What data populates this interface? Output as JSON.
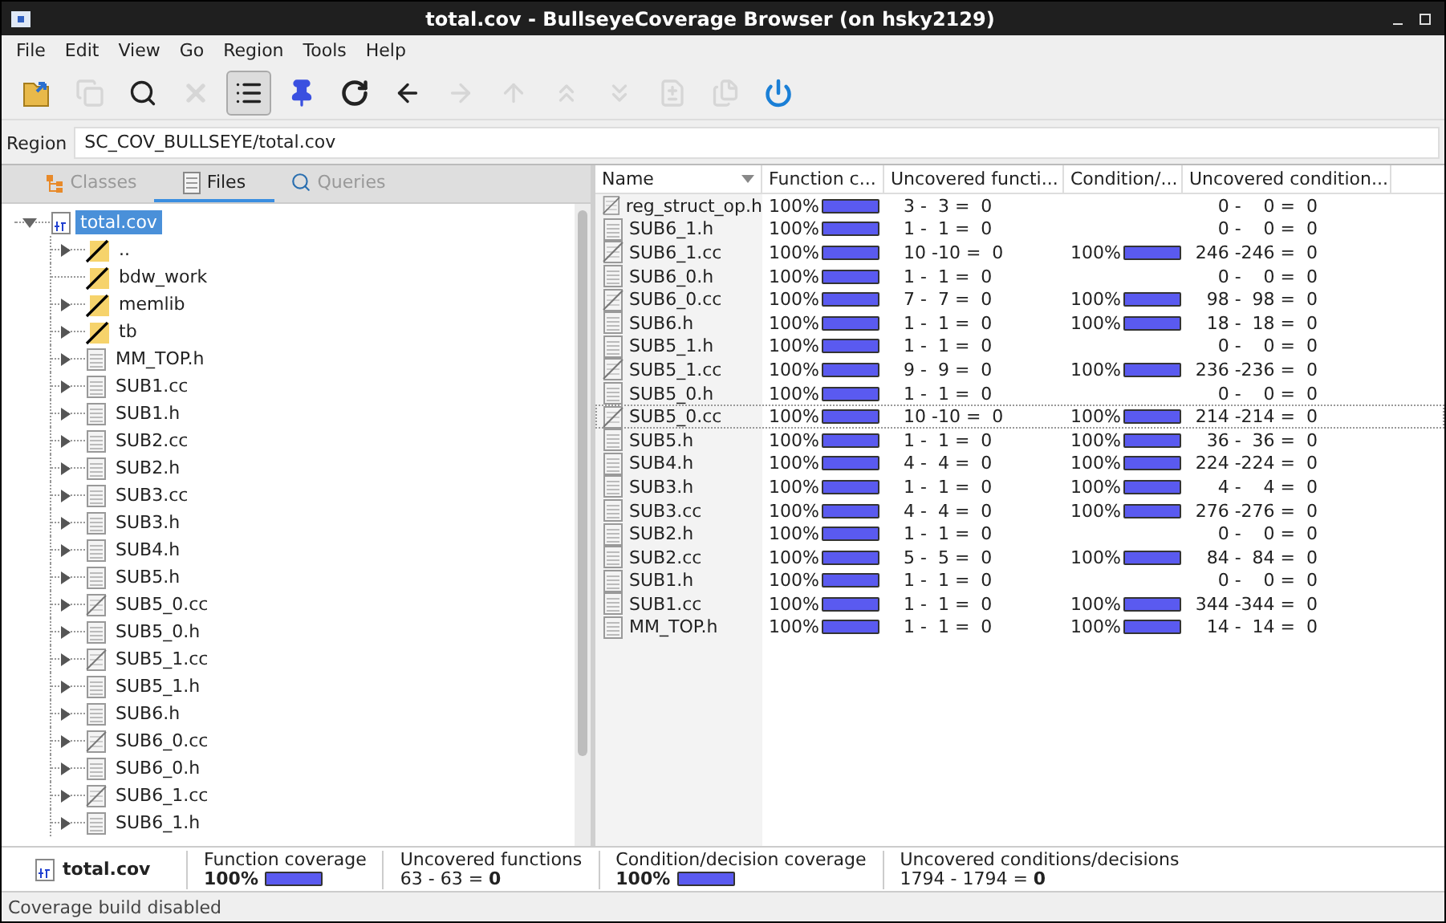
{
  "window": {
    "title": "total.cov - BullseyeCoverage Browser (on hsky2129)"
  },
  "menu": [
    "File",
    "Edit",
    "View",
    "Go",
    "Region",
    "Tools",
    "Help"
  ],
  "toolbar": [
    {
      "kind": "open",
      "disabled": false,
      "pressed": false
    },
    {
      "kind": "copy",
      "disabled": true,
      "pressed": false
    },
    {
      "kind": "find",
      "disabled": false,
      "pressed": false
    },
    {
      "kind": "delete",
      "disabled": true,
      "pressed": false
    },
    {
      "kind": "list",
      "disabled": false,
      "pressed": true
    },
    {
      "kind": "pin",
      "disabled": false,
      "pressed": false
    },
    {
      "kind": "refresh",
      "disabled": false,
      "pressed": false
    },
    {
      "kind": "back",
      "disabled": false,
      "pressed": false
    },
    {
      "kind": "forward",
      "disabled": true,
      "pressed": false
    },
    {
      "kind": "up",
      "disabled": true,
      "pressed": false
    },
    {
      "kind": "first",
      "disabled": true,
      "pressed": false
    },
    {
      "kind": "last",
      "disabled": true,
      "pressed": false
    },
    {
      "kind": "compare-prev",
      "disabled": true,
      "pressed": false
    },
    {
      "kind": "compare-next",
      "disabled": true,
      "pressed": false
    },
    {
      "kind": "power",
      "disabled": false,
      "pressed": false
    }
  ],
  "region": {
    "label": "Region",
    "value": "SC_COV_BULLSEYE/total.cov"
  },
  "tabs": [
    {
      "label": "Classes",
      "kind": "classes",
      "selected": false,
      "disabled": true
    },
    {
      "label": "Files",
      "kind": "files",
      "selected": true,
      "disabled": false
    },
    {
      "label": "Queries",
      "kind": "queries",
      "selected": false,
      "disabled": true
    }
  ],
  "tree": [
    {
      "label": "total.cov",
      "kind": "cov",
      "selected": true,
      "expanded": true,
      "children": [
        {
          "label": "..",
          "kind": "folder",
          "expandable": true
        },
        {
          "label": "bdw_work",
          "kind": "folder",
          "expandable": false
        },
        {
          "label": "memlib",
          "kind": "folder",
          "expandable": true
        },
        {
          "label": "tb",
          "kind": "folder",
          "expandable": true
        },
        {
          "label": "MM_TOP.h",
          "kind": "file",
          "expandable": true
        },
        {
          "label": "SUB1.cc",
          "kind": "file",
          "expandable": true
        },
        {
          "label": "SUB1.h",
          "kind": "file",
          "expandable": true
        },
        {
          "label": "SUB2.cc",
          "kind": "file",
          "expandable": true
        },
        {
          "label": "SUB2.h",
          "kind": "file",
          "expandable": true
        },
        {
          "label": "SUB3.cc",
          "kind": "file",
          "expandable": true
        },
        {
          "label": "SUB3.h",
          "kind": "file",
          "expandable": true
        },
        {
          "label": "SUB4.h",
          "kind": "file",
          "expandable": true
        },
        {
          "label": "SUB5.h",
          "kind": "file",
          "expandable": true
        },
        {
          "label": "SUB5_0.cc",
          "kind": "file-partial",
          "expandable": true
        },
        {
          "label": "SUB5_0.h",
          "kind": "file",
          "expandable": true
        },
        {
          "label": "SUB5_1.cc",
          "kind": "file-partial",
          "expandable": true
        },
        {
          "label": "SUB5_1.h",
          "kind": "file",
          "expandable": true
        },
        {
          "label": "SUB6.h",
          "kind": "file",
          "expandable": true
        },
        {
          "label": "SUB6_0.cc",
          "kind": "file-partial",
          "expandable": true
        },
        {
          "label": "SUB6_0.h",
          "kind": "file",
          "expandable": true
        },
        {
          "label": "SUB6_1.cc",
          "kind": "file-partial",
          "expandable": true
        },
        {
          "label": "SUB6_1.h",
          "kind": "file",
          "expandable": true
        }
      ]
    }
  ],
  "table": {
    "columns": [
      "Name",
      "Function c...",
      "Uncovered functi...",
      "Condition/...",
      "Uncovered condition..."
    ],
    "rows": [
      {
        "name": "reg_struct_op.h",
        "kind": "file-partial",
        "selected": false,
        "function_coverage": {
          "value": "100%",
          "level": 1
        },
        "uncovered_functions": "3 -  3 =  0",
        "uncovered_conditions": "0 -    0 =  0"
      },
      {
        "name": "SUB6_1.h",
        "kind": "file",
        "selected": false,
        "function_coverage": {
          "value": "100%",
          "level": 1
        },
        "uncovered_functions": "1 -  1 =  0",
        "uncovered_conditions": "0 -    0 =  0"
      },
      {
        "name": "SUB6_1.cc",
        "kind": "file-partial",
        "selected": false,
        "function_coverage": {
          "value": "100%",
          "level": 1
        },
        "uncovered_functions": "10 -10 =  0",
        "condition_coverage": {
          "value": "100%",
          "level": 1
        },
        "uncovered_conditions": "246 -246 =  0"
      },
      {
        "name": "SUB6_0.h",
        "kind": "file",
        "selected": false,
        "function_coverage": {
          "value": "100%",
          "level": 1
        },
        "uncovered_functions": "1 -  1 =  0",
        "uncovered_conditions": "0 -    0 =  0"
      },
      {
        "name": "SUB6_0.cc",
        "kind": "file-partial",
        "selected": false,
        "function_coverage": {
          "value": "100%",
          "level": 1
        },
        "uncovered_functions": "7 -  7 =  0",
        "condition_coverage": {
          "value": "100%",
          "level": 1
        },
        "uncovered_conditions": "98 -  98 =  0"
      },
      {
        "name": "SUB6.h",
        "kind": "file",
        "selected": false,
        "function_coverage": {
          "value": "100%",
          "level": 1
        },
        "uncovered_functions": "1 -  1 =  0",
        "condition_coverage": {
          "value": "100%",
          "level": 1
        },
        "uncovered_conditions": "18 -  18 =  0"
      },
      {
        "name": "SUB5_1.h",
        "kind": "file",
        "selected": false,
        "function_coverage": {
          "value": "100%",
          "level": 1
        },
        "uncovered_functions": "1 -  1 =  0",
        "uncovered_conditions": "0 -    0 =  0"
      },
      {
        "name": "SUB5_1.cc",
        "kind": "file-partial",
        "selected": false,
        "function_coverage": {
          "value": "100%",
          "level": 1
        },
        "uncovered_functions": "9 -  9 =  0",
        "condition_coverage": {
          "value": "100%",
          "level": 1
        },
        "uncovered_conditions": "236 -236 =  0"
      },
      {
        "name": "SUB5_0.h",
        "kind": "file",
        "selected": false,
        "function_coverage": {
          "value": "100%",
          "level": 1
        },
        "uncovered_functions": "1 -  1 =  0",
        "uncovered_conditions": "0 -    0 =  0"
      },
      {
        "name": "SUB5_0.cc",
        "kind": "file-partial",
        "selected": true,
        "function_coverage": {
          "value": "100%",
          "level": 1
        },
        "uncovered_functions": "10 -10 =  0",
        "condition_coverage": {
          "value": "100%",
          "level": 1
        },
        "uncovered_conditions": "214 -214 =  0"
      },
      {
        "name": "SUB5.h",
        "kind": "file",
        "selected": false,
        "function_coverage": {
          "value": "100%",
          "level": 1
        },
        "uncovered_functions": "1 -  1 =  0",
        "condition_coverage": {
          "value": "100%",
          "level": 1
        },
        "uncovered_conditions": "36 -  36 =  0"
      },
      {
        "name": "SUB4.h",
        "kind": "file",
        "selected": false,
        "function_coverage": {
          "value": "100%",
          "level": 1
        },
        "uncovered_functions": "4 -  4 =  0",
        "condition_coverage": {
          "value": "100%",
          "level": 1
        },
        "uncovered_conditions": "224 -224 =  0"
      },
      {
        "name": "SUB3.h",
        "kind": "file",
        "selected": false,
        "function_coverage": {
          "value": "100%",
          "level": 1
        },
        "uncovered_functions": "1 -  1 =  0",
        "condition_coverage": {
          "value": "100%",
          "level": 1
        },
        "uncovered_conditions": "4 -    4 =  0"
      },
      {
        "name": "SUB3.cc",
        "kind": "file",
        "selected": false,
        "function_coverage": {
          "value": "100%",
          "level": 1
        },
        "uncovered_functions": "4 -  4 =  0",
        "condition_coverage": {
          "value": "100%",
          "level": 1
        },
        "uncovered_conditions": "276 -276 =  0"
      },
      {
        "name": "SUB2.h",
        "kind": "file",
        "selected": false,
        "function_coverage": {
          "value": "100%",
          "level": 1
        },
        "uncovered_functions": "1 -  1 =  0",
        "uncovered_conditions": "0 -    0 =  0"
      },
      {
        "name": "SUB2.cc",
        "kind": "file",
        "selected": false,
        "function_coverage": {
          "value": "100%",
          "level": 1
        },
        "uncovered_functions": "5 -  5 =  0",
        "condition_coverage": {
          "value": "100%",
          "level": 1
        },
        "uncovered_conditions": "84 -  84 =  0"
      },
      {
        "name": "SUB1.h",
        "kind": "file",
        "selected": false,
        "function_coverage": {
          "value": "100%",
          "level": 1
        },
        "uncovered_functions": "1 -  1 =  0",
        "uncovered_conditions": "0 -    0 =  0"
      },
      {
        "name": "SUB1.cc",
        "kind": "file",
        "selected": false,
        "function_coverage": {
          "value": "100%",
          "level": 1
        },
        "uncovered_functions": "1 -  1 =  0",
        "condition_coverage": {
          "value": "100%",
          "level": 1
        },
        "uncovered_conditions": "344 -344 =  0"
      },
      {
        "name": "MM_TOP.h",
        "kind": "file",
        "selected": false,
        "function_coverage": {
          "value": "100%",
          "level": 1
        },
        "uncovered_functions": "1 -  1 =  0",
        "condition_coverage": {
          "value": "100%",
          "level": 1
        },
        "uncovered_conditions": "14 -  14 =  0"
      }
    ]
  },
  "summary": {
    "name": "total.cov",
    "sections": [
      {
        "label": "Function coverage",
        "value": "100%",
        "level": 1
      },
      {
        "label": "Uncovered functions",
        "value": "63 - 63 = **0**"
      },
      {
        "label": "Condition/decision coverage",
        "value": "100%",
        "level": 1
      },
      {
        "label": "Uncovered conditions/decisions",
        "value": "1794 - 1794 = **0**"
      }
    ]
  },
  "status_bar": "Coverage build disabled"
}
